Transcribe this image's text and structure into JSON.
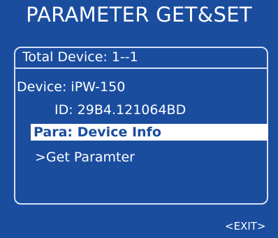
{
  "title": "PARAMETER GET&SET",
  "panel": {
    "total_device": "Total Device: 1--1",
    "device": "Device: iPW-150",
    "id": "ID: 29B4.121064BD",
    "para_selected": "Para: Device Info",
    "get_param": ">Get Paramter"
  },
  "footer": {
    "exit_label": "<EXIT>"
  },
  "colors": {
    "background": "#1b4d9f",
    "text": "#ffffff",
    "border": "#d6e1f5",
    "highlight_bg": "#ffffff",
    "highlight_text": "#1b4d9f"
  }
}
